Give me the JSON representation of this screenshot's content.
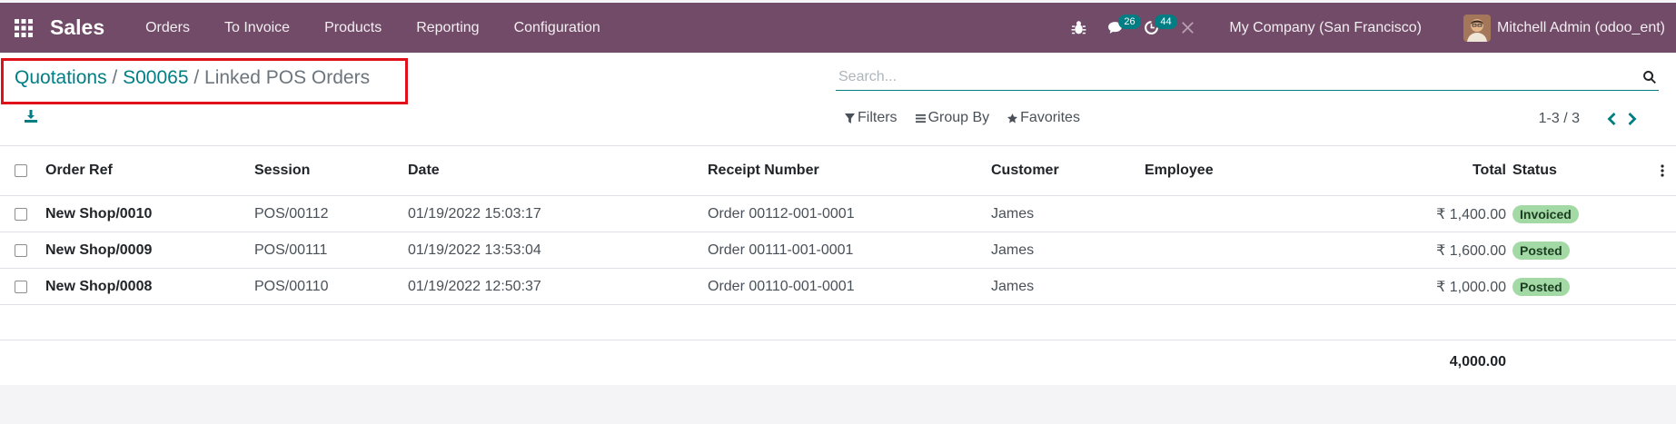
{
  "nav": {
    "app_name": "Sales",
    "menu": [
      "Orders",
      "To Invoice",
      "Products",
      "Reporting",
      "Configuration"
    ],
    "messages_count": "26",
    "activities_count": "44",
    "company": "My Company (San Francisco)",
    "user": "Mitchell Admin (odoo_ent)"
  },
  "breadcrumb": {
    "item1": "Quotations",
    "sep1": " / ",
    "item2": "S00065",
    "sep2": " / ",
    "current": "Linked POS Orders"
  },
  "search": {
    "placeholder": "Search..."
  },
  "filters": {
    "filters_label": "Filters",
    "group_by_label": "Group By",
    "favorites_label": "Favorites"
  },
  "pager": {
    "value": "1-3 / 3"
  },
  "table": {
    "headers": {
      "order_ref": "Order Ref",
      "session": "Session",
      "date": "Date",
      "receipt": "Receipt Number",
      "customer": "Customer",
      "employee": "Employee",
      "total": "Total",
      "status": "Status"
    },
    "rows": [
      {
        "order_ref": "New Shop/0010",
        "session": "POS/00112",
        "date": "01/19/2022 15:03:17",
        "receipt": "Order 00112-001-0001",
        "customer": "James",
        "employee": "",
        "total": "₹ 1,400.00",
        "status": "Invoiced"
      },
      {
        "order_ref": "New Shop/0009",
        "session": "POS/00111",
        "date": "01/19/2022 13:53:04",
        "receipt": "Order 00111-001-0001",
        "customer": "James",
        "employee": "",
        "total": "₹ 1,600.00",
        "status": "Posted"
      },
      {
        "order_ref": "New Shop/0008",
        "session": "POS/00110",
        "date": "01/19/2022 12:50:37",
        "receipt": "Order 00110-001-0001",
        "customer": "James",
        "employee": "",
        "total": "₹ 1,000.00",
        "status": "Posted"
      }
    ],
    "grand_total": "4,000.00"
  },
  "colors": {
    "brand": "#714b67",
    "accent": "#017e84",
    "highlight_box": "#e0101a",
    "status_badge": "#a3d9a5"
  },
  "icons": [
    "apps-grid-icon",
    "bug-icon",
    "chat-icon",
    "activity-clock-icon",
    "tools-icon",
    "download-icon",
    "search-icon",
    "filter-icon",
    "group-by-icon",
    "star-icon",
    "chevron-left-icon",
    "chevron-right-icon",
    "kebab-icon"
  ]
}
